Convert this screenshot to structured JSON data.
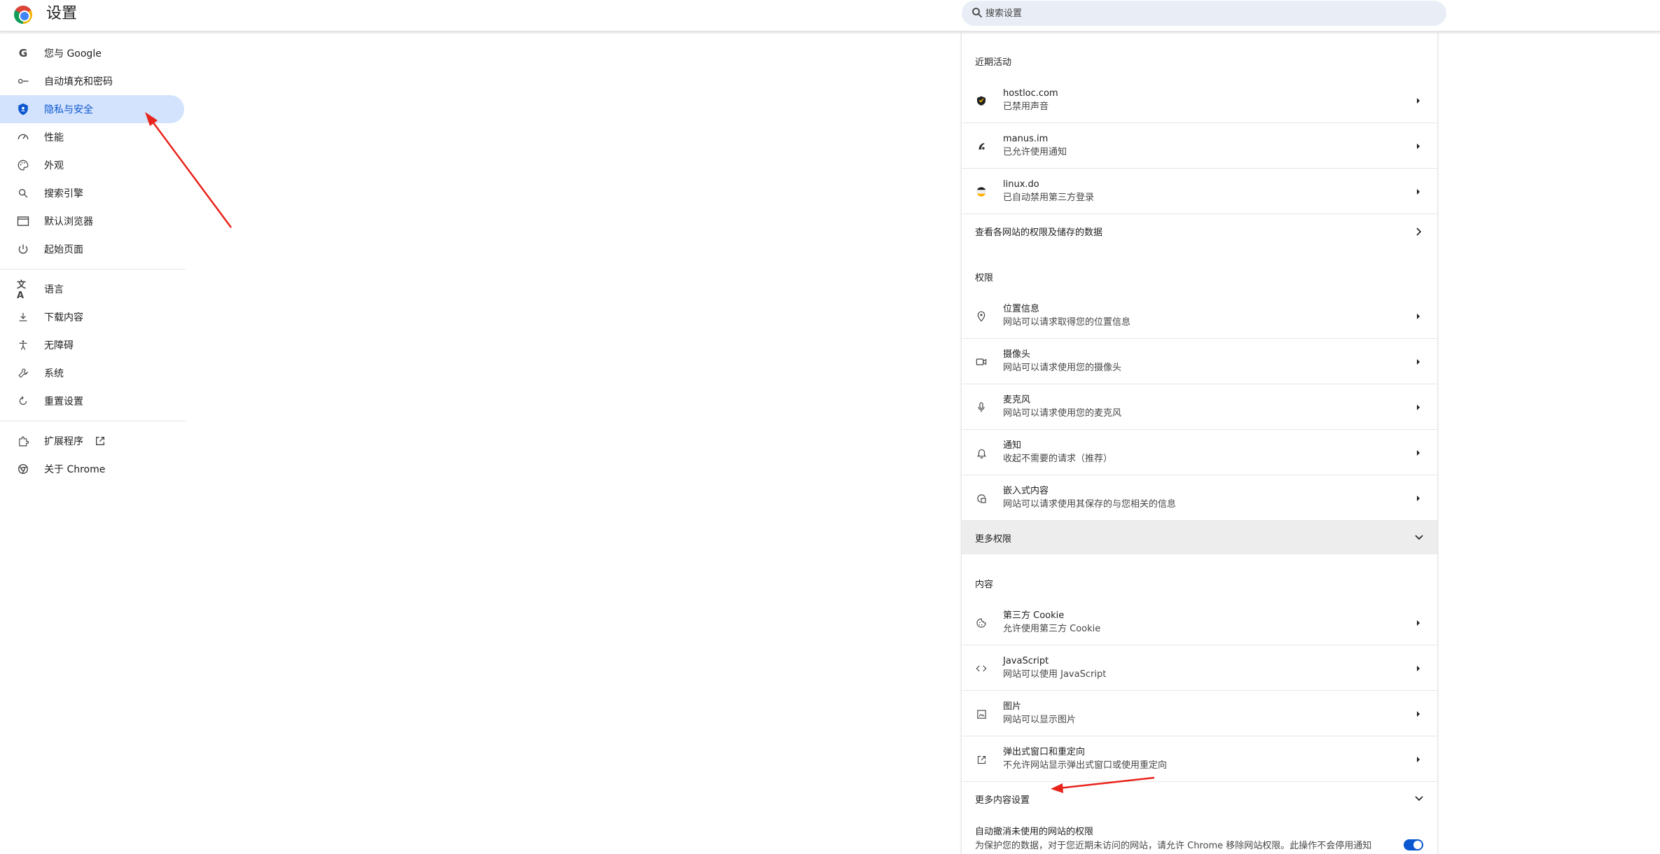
{
  "header": {
    "title": "设置",
    "search_placeholder": "搜索设置"
  },
  "sidebar": {
    "groups": [
      [
        {
          "label": "您与 Google",
          "icon": "google-g-icon"
        },
        {
          "label": "自动填充和密码",
          "icon": "key-icon"
        },
        {
          "label": "隐私与安全",
          "icon": "shield-icon",
          "active": true
        },
        {
          "label": "性能",
          "icon": "speedometer-icon"
        },
        {
          "label": "外观",
          "icon": "palette-icon"
        },
        {
          "label": "搜索引擎",
          "icon": "search-icon"
        },
        {
          "label": "默认浏览器",
          "icon": "browser-window-icon"
        },
        {
          "label": "起始页面",
          "icon": "power-icon"
        }
      ],
      [
        {
          "label": "语言",
          "icon": "translate-icon"
        },
        {
          "label": "下载内容",
          "icon": "download-icon"
        },
        {
          "label": "无障碍",
          "icon": "accessibility-icon"
        },
        {
          "label": "系统",
          "icon": "wrench-icon"
        },
        {
          "label": "重置设置",
          "icon": "reset-icon"
        }
      ],
      [
        {
          "label": "扩展程序",
          "icon": "puzzle-icon"
        },
        {
          "label": "关于 Chrome",
          "icon": "chrome-icon"
        }
      ]
    ]
  },
  "main": {
    "recent": {
      "label": "近期活动",
      "items": [
        {
          "title": "hostloc.com",
          "sub": "已禁用声音",
          "icon": "hostloc-site-icon"
        },
        {
          "title": "manus.im",
          "sub": "已允许使用通知",
          "icon": "manus-site-icon"
        },
        {
          "title": "linux.do",
          "sub": "已自动禁用第三方登录",
          "icon": "linuxdo-site-icon"
        }
      ],
      "view_all": "查看各网站的权限及储存的数据"
    },
    "permissions": {
      "label": "权限",
      "items": [
        {
          "title": "位置信息",
          "sub": "网站可以请求取得您的位置信息",
          "icon": "location-pin-icon"
        },
        {
          "title": "摄像头",
          "sub": "网站可以请求使用您的摄像头",
          "icon": "camera-icon"
        },
        {
          "title": "麦克风",
          "sub": "网站可以请求使用您的麦克风",
          "icon": "microphone-icon"
        },
        {
          "title": "通知",
          "sub": "收起不需要的请求（推荐）",
          "icon": "bell-icon"
        },
        {
          "title": "嵌入式内容",
          "sub": "网站可以请求使用其保存的与您相关的信息",
          "icon": "embedded-content-icon"
        }
      ],
      "more": "更多权限"
    },
    "content": {
      "label": "内容",
      "items": [
        {
          "title": "第三方 Cookie",
          "sub": "允许使用第三方 Cookie",
          "icon": "cookie-icon"
        },
        {
          "title": "JavaScript",
          "sub": "网站可以使用 JavaScript",
          "icon": "code-brackets-icon"
        },
        {
          "title": "图片",
          "sub": "网站可以显示图片",
          "icon": "image-icon"
        },
        {
          "title": "弹出式窗口和重定向",
          "sub": "不允许网站显示弹出式窗口或使用重定向",
          "icon": "open-external-icon"
        }
      ],
      "more": "更多内容设置"
    },
    "auto_revoke": {
      "title": "自动撤消未使用的网站的权限",
      "sub": "为保护您的数据，对于您近期未访问的网站，请允许 Chrome 移除网站权限。此操作不会停用通知功能。",
      "enabled": true
    }
  },
  "colors": {
    "accent": "#0b57d0",
    "active_bg": "#d3e3fd",
    "annotation": "#e8231b"
  }
}
